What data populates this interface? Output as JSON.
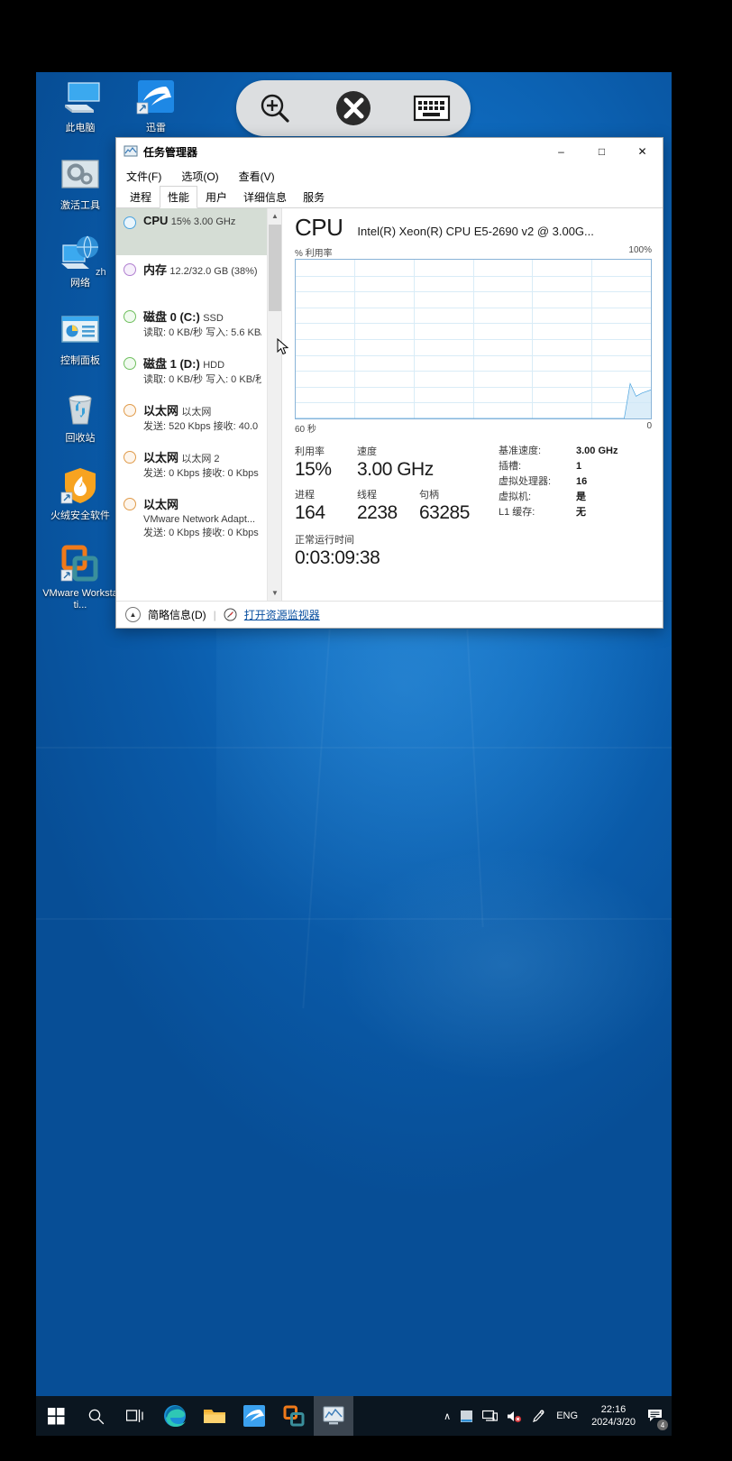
{
  "desktop": {
    "icons": [
      {
        "name": "this-pc",
        "label": "此电脑"
      },
      {
        "name": "thunder",
        "label": "迅雷"
      },
      {
        "name": "activation-tool",
        "label": "激活工具"
      },
      {
        "name": "network",
        "label": "网络"
      },
      {
        "name": "control-panel",
        "label": "控制面板"
      },
      {
        "name": "recycle-bin",
        "label": "回收站"
      },
      {
        "name": "huorong",
        "label": "火绒安全软件"
      },
      {
        "name": "vmware",
        "label": "VMware Workstati..."
      }
    ],
    "ime_indicator": "zh"
  },
  "float_toolbar": {
    "buttons": [
      {
        "name": "zoom-in-icon",
        "label": ""
      },
      {
        "name": "remote-desktop-icon",
        "label": ""
      },
      {
        "name": "keyboard-icon",
        "label": ""
      }
    ]
  },
  "taskmgr": {
    "title": "任务管理器",
    "window_buttons": {
      "minimize": "–",
      "maximize": "□",
      "close": "✕"
    },
    "menus": [
      "文件(F)",
      "选项(O)",
      "查看(V)"
    ],
    "tabs": [
      {
        "label": "进程",
        "active": false
      },
      {
        "label": "性能",
        "active": true
      },
      {
        "label": "用户",
        "active": false
      },
      {
        "label": "详细信息",
        "active": false
      },
      {
        "label": "服务",
        "active": false
      }
    ],
    "sidebar": [
      {
        "name": "CPU",
        "sub": "15%  3.00 GHz",
        "sub2": "",
        "color": "#4aa3df",
        "selected": true
      },
      {
        "name": "内存",
        "sub": "12.2/32.0 GB (38%)",
        "sub2": "",
        "color": "#b07fd0",
        "selected": false
      },
      {
        "name": "磁盘 0 (C:)",
        "sub": "SSD",
        "sub2": "读取: 0 KB/秒 写入: 5.6 KB/",
        "color": "#6fbf5e",
        "selected": false
      },
      {
        "name": "磁盘 1 (D:)",
        "sub": "HDD",
        "sub2": "读取: 0 KB/秒 写入: 0 KB/秒",
        "color": "#6fbf5e",
        "selected": false
      },
      {
        "name": "以太网",
        "sub": "以太网",
        "sub2": "发送: 520 Kbps 接收: 40.0",
        "color": "#e09b4a",
        "selected": false
      },
      {
        "name": "以太网",
        "sub": "以太网 2",
        "sub2": "发送: 0 Kbps 接收: 0 Kbps",
        "color": "#e09b4a",
        "selected": false
      },
      {
        "name": "以太网",
        "sub": "VMware Network Adapt...",
        "sub2": "发送: 0 Kbps 接收: 0 Kbps",
        "color": "#e09b4a",
        "selected": false
      }
    ],
    "main": {
      "heading": "CPU",
      "model": "Intel(R) Xeon(R) CPU E5-2690 v2 @ 3.00G...",
      "graph_label_left": "% 利用率",
      "graph_label_right": "100%",
      "graph_foot_left": "60 秒",
      "graph_foot_right": "0",
      "stats": [
        {
          "key": "利用率",
          "value": "15%"
        },
        {
          "key": "速度",
          "value": "3.00 GHz"
        },
        {
          "key": "进程",
          "value": "164"
        },
        {
          "key": "线程",
          "value": "2238"
        },
        {
          "key": "句柄",
          "value": "63285"
        }
      ],
      "uptime": {
        "key": "正常运行时间",
        "value": "0:03:09:38"
      },
      "details": [
        {
          "key": "基准速度:",
          "value": "3.00 GHz"
        },
        {
          "key": "插槽:",
          "value": "1"
        },
        {
          "key": "虚拟处理器:",
          "value": "16"
        },
        {
          "key": "虚拟机:",
          "value": "是"
        },
        {
          "key": "L1 缓存:",
          "value": "无"
        }
      ]
    },
    "footer": {
      "fewer_details": "简略信息(D)",
      "separator": "|",
      "resource_monitor": "打开资源监视器"
    }
  },
  "chart_data": {
    "type": "line",
    "title": "% 利用率",
    "xlabel": "60 秒",
    "ylabel": "% 利用率",
    "ylim": [
      0,
      100
    ],
    "xlim": [
      0,
      60
    ],
    "grid": true,
    "legend": "none",
    "series": [
      {
        "name": "CPU 利用率",
        "points": [
          [
            0,
            0
          ],
          [
            4,
            0
          ],
          [
            8,
            0
          ],
          [
            12,
            0
          ],
          [
            16,
            0
          ],
          [
            20,
            0
          ],
          [
            24,
            0
          ],
          [
            28,
            0
          ],
          [
            32,
            0
          ],
          [
            36,
            0
          ],
          [
            40,
            0
          ],
          [
            44,
            0
          ],
          [
            48,
            0
          ],
          [
            52,
            0
          ],
          [
            54,
            0
          ],
          [
            55.5,
            0
          ],
          [
            56.5,
            22
          ],
          [
            57.5,
            14
          ],
          [
            58.5,
            16
          ],
          [
            60,
            18
          ]
        ]
      }
    ]
  },
  "taskbar": {
    "buttons": [
      {
        "name": "start-button",
        "label": ""
      },
      {
        "name": "search-icon",
        "label": ""
      },
      {
        "name": "task-view-icon",
        "label": ""
      },
      {
        "name": "edge-icon",
        "label": ""
      },
      {
        "name": "file-explorer-icon",
        "label": ""
      },
      {
        "name": "thunder-icon",
        "label": ""
      },
      {
        "name": "vmware-icon",
        "label": ""
      },
      {
        "name": "task-manager-icon",
        "label": ""
      }
    ],
    "tray": {
      "chevron": "∧",
      "items": [
        "tablet-mode-icon",
        "network-icon",
        "volume-muted-icon",
        "pen-icon"
      ],
      "language": "ENG",
      "time": "22:16",
      "date": "2024/3/20",
      "notification_count": "4"
    }
  }
}
